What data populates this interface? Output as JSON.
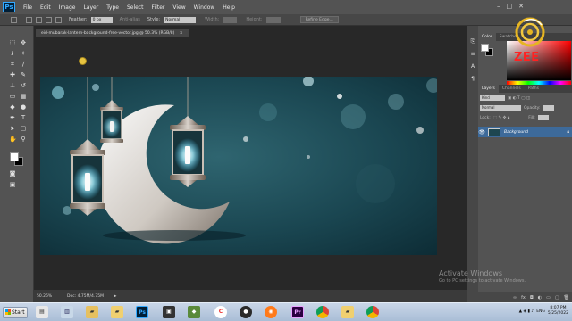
{
  "app": {
    "logo": "Ps"
  },
  "menubar": {
    "items": [
      "File",
      "Edit",
      "Image",
      "Layer",
      "Type",
      "Select",
      "Filter",
      "View",
      "Window",
      "Help"
    ],
    "window_controls": [
      "–",
      "□",
      "✕"
    ]
  },
  "options_bar": {
    "feather_label": "Feather:",
    "feather_value": "0 px",
    "anti_alias_label": "Anti-alias",
    "style_label": "Style:",
    "style_value": "Normal",
    "width_label": "Width:",
    "height_label": "Height:",
    "refine_edge_label": "Refine Edge..."
  },
  "document": {
    "tab_title": "eid-mubarak-lantern-background-free-vector.jpg @ 50.3% (RGB/8)",
    "tab_close": "×",
    "zoom_level": "50.26%",
    "doc_size": "Doc: 4.75M/4.75M",
    "status_arrow": "▶"
  },
  "color_panel": {
    "tabs": [
      "Color",
      "Swatches"
    ],
    "foreground": "#ffffff",
    "background": "#000000"
  },
  "layers_panel": {
    "tabs": [
      "Layers",
      "Channels",
      "Paths"
    ],
    "filter_label": "Kind",
    "blend_mode": "Normal",
    "opacity_label": "Opacity:",
    "lock_label": "Lock:",
    "fill_label": "Fill:",
    "layer_name": "Background"
  },
  "overlay": {
    "brand_text": "ZEE"
  },
  "watermark": {
    "title": "Activate Windows",
    "subtitle": "Go to PC settings to activate Windows."
  },
  "taskbar": {
    "start_label": "Start",
    "apps": [
      "Ps",
      "Pr"
    ],
    "tray_language": "ENG",
    "time": "8:07 PM",
    "date": "5/25/2022"
  },
  "colors": {
    "accent_selection": "#3d6a9a",
    "canvas_teal": "#1d4650",
    "brand_red": "#ff2222"
  }
}
